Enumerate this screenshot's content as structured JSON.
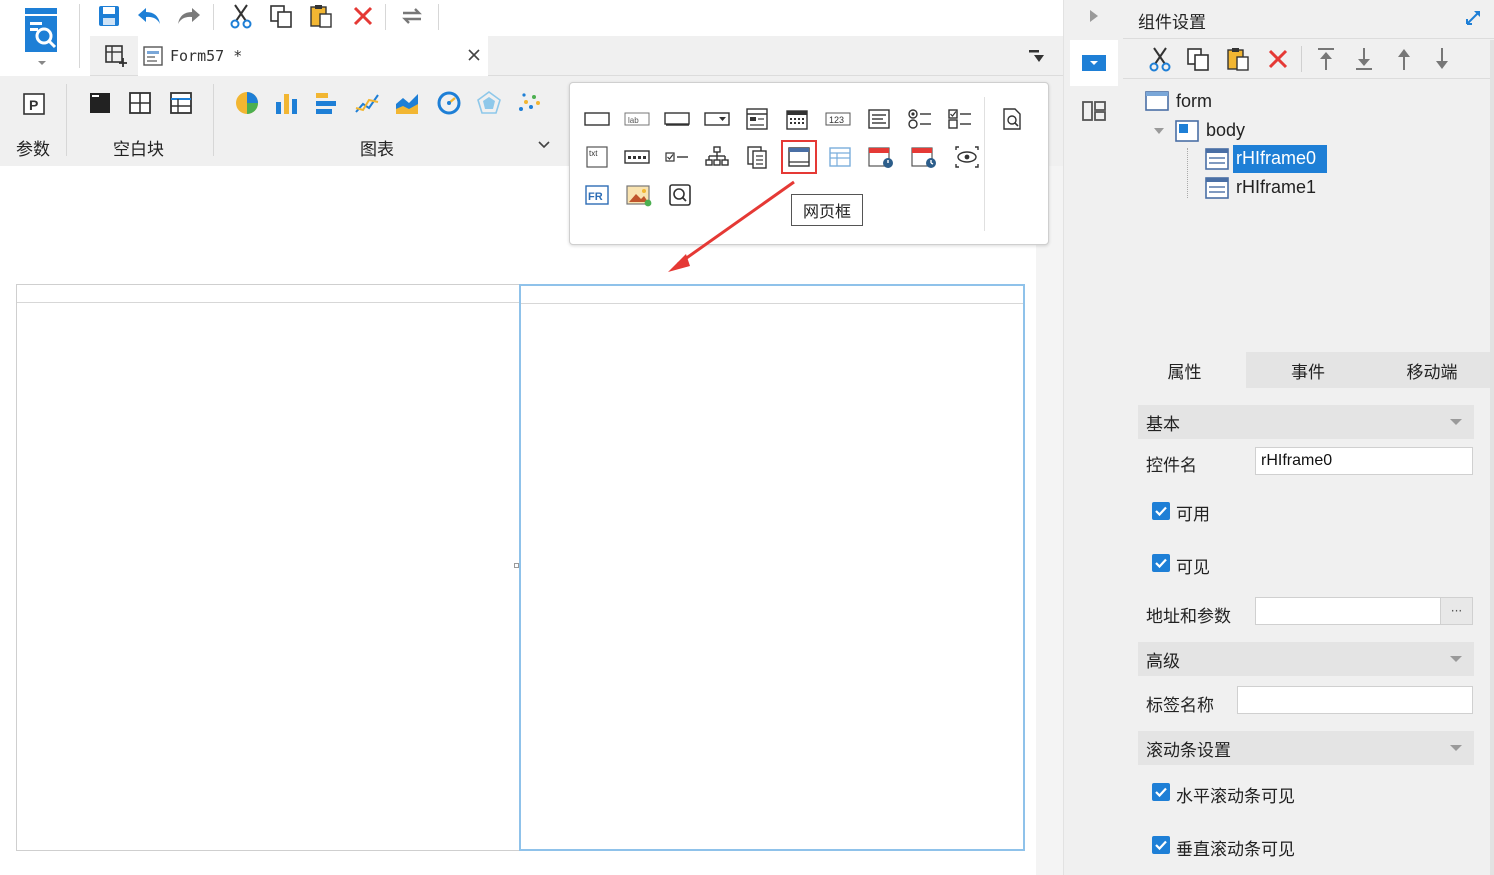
{
  "app": {
    "file_tab": {
      "label": "Form57 *"
    }
  },
  "ribbon": {
    "groups": [
      {
        "label": "参数"
      },
      {
        "label": "空白块"
      },
      {
        "label": "图表"
      }
    ]
  },
  "widget_popup": {
    "tooltip": "网页框"
  },
  "right_panel": {
    "title": "组件设置",
    "tree": {
      "form": "form",
      "body": "body",
      "items": [
        "rHIframe0",
        "rHIframe1"
      ]
    },
    "tabs": [
      "属性",
      "事件",
      "移动端"
    ],
    "sections": {
      "basic": "基本",
      "advanced": "高级",
      "scrollbar": "滚动条设置"
    },
    "props": {
      "widget_name_label": "控件名",
      "widget_name_value": "rHIframe0",
      "enabled_label": "可用",
      "visible_label": "可见",
      "url_params_label": "地址和参数",
      "url_params_button": "···",
      "tag_name_label": "标签名称",
      "hscroll_label": "水平滚动条可见",
      "vscroll_label": "垂直滚动条可见"
    }
  },
  "colors": {
    "accent": "#1e7fd6",
    "selected_bg": "#1e7fd6",
    "frame_selected_border": "#8fc2ea",
    "annotation_red": "#e53935"
  }
}
